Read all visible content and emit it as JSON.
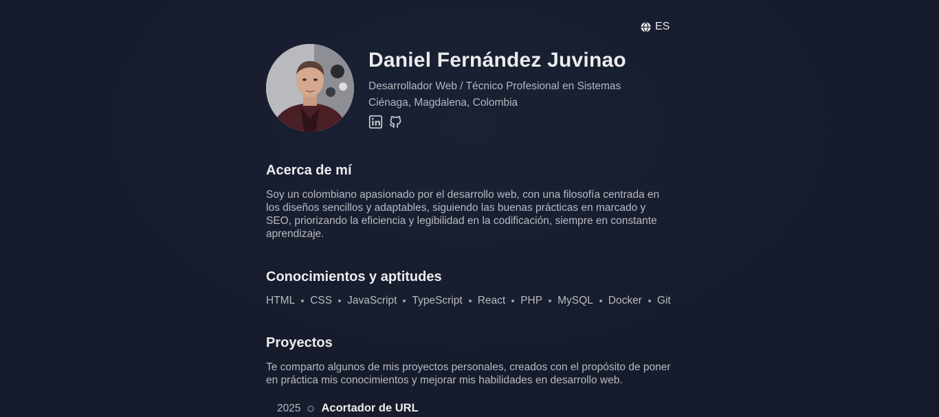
{
  "language": {
    "icon": "globe-icon",
    "label": "ES"
  },
  "profile": {
    "name": "Daniel Fernández Juvinao",
    "role": "Desarrollador Web / Técnico Profesional en Sistemas",
    "location": "Ciénaga, Magdalena, Colombia",
    "socials": [
      {
        "icon": "linkedin-icon"
      },
      {
        "icon": "github-icon"
      }
    ]
  },
  "about": {
    "title": "Acerca de mí",
    "text": "Soy un colombiano apasionado por el desarrollo web, con una filosofía centrada en los diseños sencillos y adaptables, siguiendo las buenas prácticas en marcado y SEO, priorizando la eficiencia y legibilidad en la codificación, siempre en constante aprendizaje."
  },
  "skills": {
    "title": "Conocimientos y aptitudes",
    "items": [
      "HTML",
      "CSS",
      "JavaScript",
      "TypeScript",
      "React",
      "PHP",
      "MySQL",
      "Docker",
      "Git"
    ]
  },
  "projects": {
    "title": "Proyectos",
    "text": "Te comparto algunos de mis proyectos personales, creados con el propósito de poner en práctica mis conocimientos y mejorar mis habilidades en desarrollo web.",
    "items": [
      {
        "year": "2025",
        "name": "Acortador de URL"
      }
    ]
  }
}
